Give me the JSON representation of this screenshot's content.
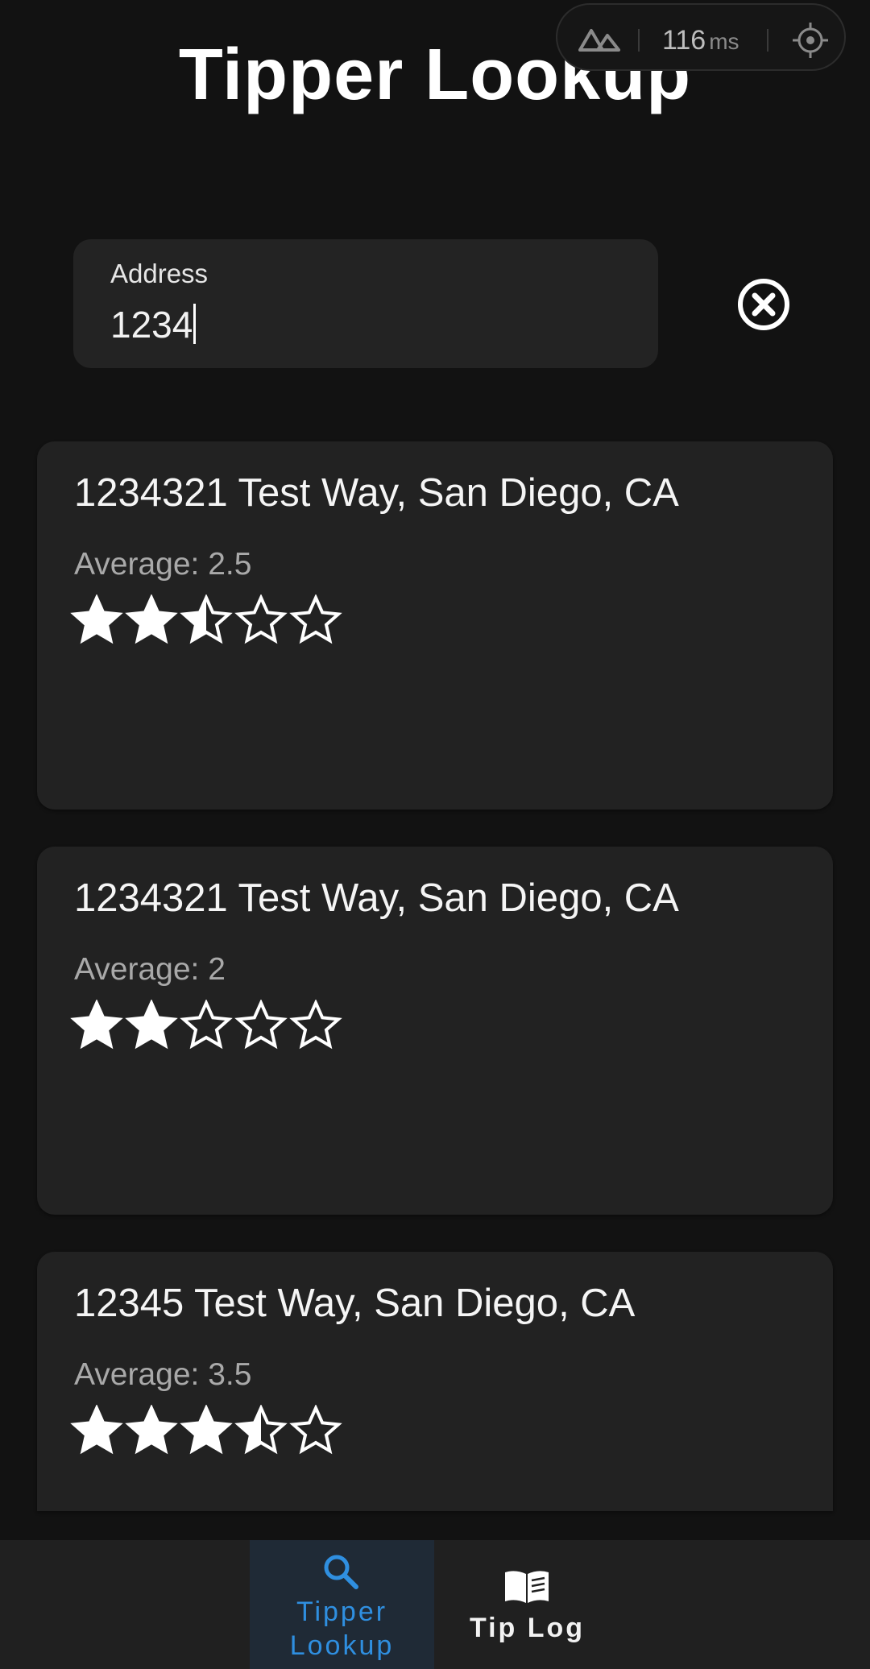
{
  "header": {
    "title": "Tipper Lookup"
  },
  "dev_overlay": {
    "latency_value": "116",
    "latency_unit": "ms",
    "logo_icon": "nuxt-logo-icon",
    "inspect_icon": "crosshair-icon"
  },
  "search": {
    "label": "Address",
    "value": "1234",
    "clear_icon": "close-circle-icon"
  },
  "results": [
    {
      "address": "1234321 Test Way, San Diego, CA",
      "average_label": "Average: 2.5",
      "rating": 2.5,
      "max_rating": 5
    },
    {
      "address": "1234321 Test Way, San Diego, CA",
      "average_label": "Average: 2",
      "rating": 2,
      "max_rating": 5
    },
    {
      "address": "12345 Test Way, San Diego, CA",
      "average_label": "Average: 3.5",
      "rating": 3.5,
      "max_rating": 5
    }
  ],
  "bottom_nav": {
    "items": [
      {
        "label": "Tipper Lookup",
        "icon": "search-icon",
        "active": true
      },
      {
        "label": "Tip Log",
        "icon": "book-icon",
        "active": false
      }
    ]
  },
  "colors": {
    "background": "#121212",
    "card": "#222222",
    "accent": "#2f8fe0"
  }
}
